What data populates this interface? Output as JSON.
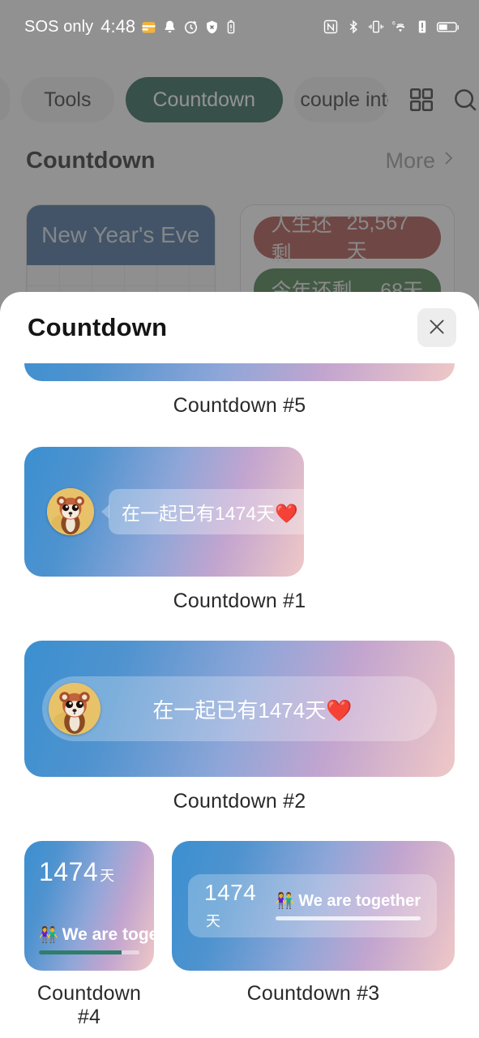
{
  "statusbar": {
    "carrier": "SOS only",
    "time": "4:48",
    "left_icons": [
      "calendar-icon",
      "bell-icon",
      "alarm-icon",
      "shield-off-icon",
      "battery-saver-icon"
    ],
    "right_icons": [
      "nfc-icon",
      "bluetooth-icon",
      "vibrate-icon",
      "wifi-6-icon",
      "alert-icon",
      "battery-icon"
    ]
  },
  "tabs": {
    "items": [
      {
        "label": "",
        "name": "tab-partial-left",
        "active": false
      },
      {
        "label": "Tools",
        "name": "tab-tools",
        "active": false
      },
      {
        "label": "Countdown",
        "name": "tab-countdown",
        "active": true
      },
      {
        "label": "couple inter",
        "name": "tab-couple-interaction",
        "active": false
      }
    ],
    "grid_icon": "grid-icon",
    "search_icon": "search-icon"
  },
  "section": {
    "title": "Countdown",
    "more_label": "More",
    "chevron": "chevron-right-icon"
  },
  "bg_cards": [
    {
      "name": "new-years-eve-widget",
      "title": "New Year's Eve"
    },
    {
      "name": "life-remaining-widget",
      "rows": [
        {
          "label": "人生还剩",
          "value": "25,567天",
          "color": "#a03a33"
        },
        {
          "label": "今年还剩",
          "value": "68天",
          "color": "#2f6b33"
        }
      ]
    }
  ],
  "sheet": {
    "title": "Countdown",
    "close_icon": "close-icon",
    "widgets": [
      {
        "name": "countdown-5",
        "label": "Countdown #5",
        "style": "sliver"
      },
      {
        "name": "countdown-1",
        "label": "Countdown #1",
        "style": "bubble",
        "avatar": "red-panda-avatar",
        "text": "在一起已有1474天",
        "emoji": "❤️"
      },
      {
        "name": "countdown-2",
        "label": "Countdown #2",
        "style": "wide-pill",
        "avatar": "red-panda-avatar",
        "text": "在一起已有1474天",
        "emoji": "❤️"
      },
      {
        "name": "countdown-4",
        "label": "Countdown #4",
        "style": "small-square",
        "days": "1474",
        "days_unit": "天",
        "together_emoji": "👫",
        "together_text": "We are toget...",
        "progress": 82
      },
      {
        "name": "countdown-3",
        "label": "Countdown #3",
        "style": "wide-card",
        "days": "1474",
        "days_unit": "天",
        "together_emoji": "👫",
        "together_text": "We are together",
        "progress": 100
      }
    ]
  },
  "colors": {
    "accent_green": "#12503f",
    "sheet_bg": "#ffffff",
    "gradient_start": "#3b8fd0",
    "gradient_end": "#efc8c6",
    "progress": "#2f7d6b"
  }
}
